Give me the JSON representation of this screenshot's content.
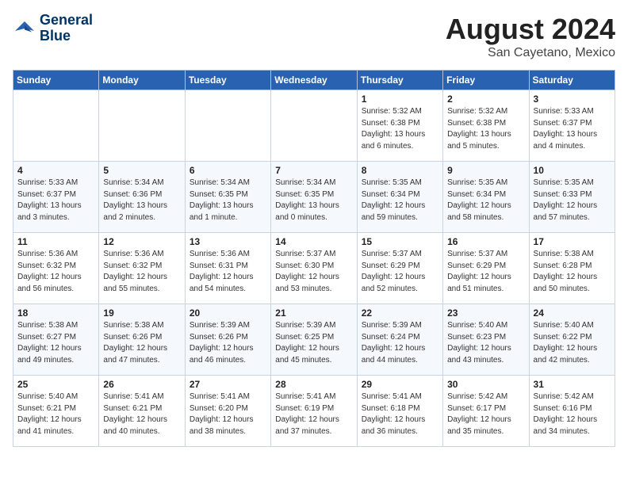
{
  "header": {
    "logo_line1": "General",
    "logo_line2": "Blue",
    "title": "August 2024",
    "location": "San Cayetano, Mexico"
  },
  "days_of_week": [
    "Sunday",
    "Monday",
    "Tuesday",
    "Wednesday",
    "Thursday",
    "Friday",
    "Saturday"
  ],
  "weeks": [
    [
      {
        "day": "",
        "info": ""
      },
      {
        "day": "",
        "info": ""
      },
      {
        "day": "",
        "info": ""
      },
      {
        "day": "",
        "info": ""
      },
      {
        "day": "1",
        "info": "Sunrise: 5:32 AM\nSunset: 6:38 PM\nDaylight: 13 hours\nand 6 minutes."
      },
      {
        "day": "2",
        "info": "Sunrise: 5:32 AM\nSunset: 6:38 PM\nDaylight: 13 hours\nand 5 minutes."
      },
      {
        "day": "3",
        "info": "Sunrise: 5:33 AM\nSunset: 6:37 PM\nDaylight: 13 hours\nand 4 minutes."
      }
    ],
    [
      {
        "day": "4",
        "info": "Sunrise: 5:33 AM\nSunset: 6:37 PM\nDaylight: 13 hours\nand 3 minutes."
      },
      {
        "day": "5",
        "info": "Sunrise: 5:34 AM\nSunset: 6:36 PM\nDaylight: 13 hours\nand 2 minutes."
      },
      {
        "day": "6",
        "info": "Sunrise: 5:34 AM\nSunset: 6:35 PM\nDaylight: 13 hours\nand 1 minute."
      },
      {
        "day": "7",
        "info": "Sunrise: 5:34 AM\nSunset: 6:35 PM\nDaylight: 13 hours\nand 0 minutes."
      },
      {
        "day": "8",
        "info": "Sunrise: 5:35 AM\nSunset: 6:34 PM\nDaylight: 12 hours\nand 59 minutes."
      },
      {
        "day": "9",
        "info": "Sunrise: 5:35 AM\nSunset: 6:34 PM\nDaylight: 12 hours\nand 58 minutes."
      },
      {
        "day": "10",
        "info": "Sunrise: 5:35 AM\nSunset: 6:33 PM\nDaylight: 12 hours\nand 57 minutes."
      }
    ],
    [
      {
        "day": "11",
        "info": "Sunrise: 5:36 AM\nSunset: 6:32 PM\nDaylight: 12 hours\nand 56 minutes."
      },
      {
        "day": "12",
        "info": "Sunrise: 5:36 AM\nSunset: 6:32 PM\nDaylight: 12 hours\nand 55 minutes."
      },
      {
        "day": "13",
        "info": "Sunrise: 5:36 AM\nSunset: 6:31 PM\nDaylight: 12 hours\nand 54 minutes."
      },
      {
        "day": "14",
        "info": "Sunrise: 5:37 AM\nSunset: 6:30 PM\nDaylight: 12 hours\nand 53 minutes."
      },
      {
        "day": "15",
        "info": "Sunrise: 5:37 AM\nSunset: 6:29 PM\nDaylight: 12 hours\nand 52 minutes."
      },
      {
        "day": "16",
        "info": "Sunrise: 5:37 AM\nSunset: 6:29 PM\nDaylight: 12 hours\nand 51 minutes."
      },
      {
        "day": "17",
        "info": "Sunrise: 5:38 AM\nSunset: 6:28 PM\nDaylight: 12 hours\nand 50 minutes."
      }
    ],
    [
      {
        "day": "18",
        "info": "Sunrise: 5:38 AM\nSunset: 6:27 PM\nDaylight: 12 hours\nand 49 minutes."
      },
      {
        "day": "19",
        "info": "Sunrise: 5:38 AM\nSunset: 6:26 PM\nDaylight: 12 hours\nand 47 minutes."
      },
      {
        "day": "20",
        "info": "Sunrise: 5:39 AM\nSunset: 6:26 PM\nDaylight: 12 hours\nand 46 minutes."
      },
      {
        "day": "21",
        "info": "Sunrise: 5:39 AM\nSunset: 6:25 PM\nDaylight: 12 hours\nand 45 minutes."
      },
      {
        "day": "22",
        "info": "Sunrise: 5:39 AM\nSunset: 6:24 PM\nDaylight: 12 hours\nand 44 minutes."
      },
      {
        "day": "23",
        "info": "Sunrise: 5:40 AM\nSunset: 6:23 PM\nDaylight: 12 hours\nand 43 minutes."
      },
      {
        "day": "24",
        "info": "Sunrise: 5:40 AM\nSunset: 6:22 PM\nDaylight: 12 hours\nand 42 minutes."
      }
    ],
    [
      {
        "day": "25",
        "info": "Sunrise: 5:40 AM\nSunset: 6:21 PM\nDaylight: 12 hours\nand 41 minutes."
      },
      {
        "day": "26",
        "info": "Sunrise: 5:41 AM\nSunset: 6:21 PM\nDaylight: 12 hours\nand 40 minutes."
      },
      {
        "day": "27",
        "info": "Sunrise: 5:41 AM\nSunset: 6:20 PM\nDaylight: 12 hours\nand 38 minutes."
      },
      {
        "day": "28",
        "info": "Sunrise: 5:41 AM\nSunset: 6:19 PM\nDaylight: 12 hours\nand 37 minutes."
      },
      {
        "day": "29",
        "info": "Sunrise: 5:41 AM\nSunset: 6:18 PM\nDaylight: 12 hours\nand 36 minutes."
      },
      {
        "day": "30",
        "info": "Sunrise: 5:42 AM\nSunset: 6:17 PM\nDaylight: 12 hours\nand 35 minutes."
      },
      {
        "day": "31",
        "info": "Sunrise: 5:42 AM\nSunset: 6:16 PM\nDaylight: 12 hours\nand 34 minutes."
      }
    ]
  ]
}
